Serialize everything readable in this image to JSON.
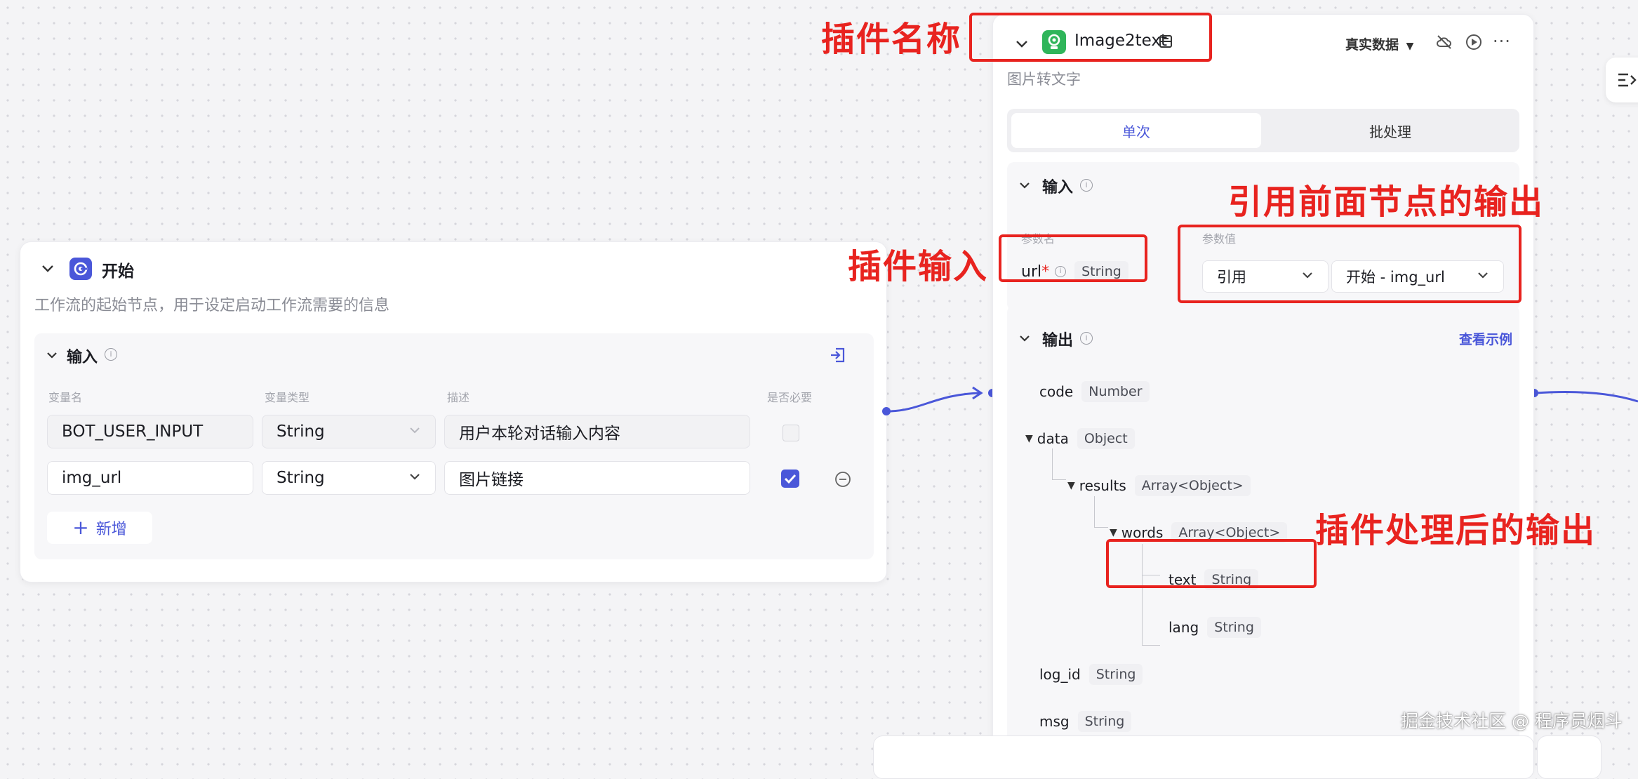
{
  "start_node": {
    "title": "开始",
    "description": "工作流的起始节点，用于设定启动工作流需要的信息",
    "input_section": {
      "title": "输入",
      "columns": [
        "变量名",
        "变量类型",
        "描述",
        "是否必要"
      ],
      "rows": [
        {
          "name": "BOT_USER_INPUT",
          "type": "String",
          "desc": "用户本轮对话输入内容",
          "required": false
        },
        {
          "name": "img_url",
          "type": "String",
          "desc": "图片链接",
          "required": true
        }
      ],
      "add_label": "新增"
    }
  },
  "plugin_node": {
    "title": "Image2text",
    "description": "图片转文字",
    "data_mode_label": "真实数据",
    "tabs": [
      "单次",
      "批处理"
    ],
    "active_tab": "单次",
    "input_section": {
      "title": "输入",
      "param_name_header": "参数名",
      "param_value_header": "参数值",
      "param": {
        "name": "url",
        "required_mark": "*",
        "type": "String"
      },
      "ref_mode": "引用",
      "ref_value": "开始 - img_url"
    },
    "output_section": {
      "title": "输出",
      "example_link": "查看示例",
      "fields": [
        {
          "name": "code",
          "type": "Number"
        },
        {
          "name": "data",
          "type": "Object"
        },
        {
          "name": "results",
          "type": "Array<Object>"
        },
        {
          "name": "words",
          "type": "Array<Object>"
        },
        {
          "name": "text",
          "type": "String"
        },
        {
          "name": "lang",
          "type": "String"
        },
        {
          "name": "log_id",
          "type": "String"
        },
        {
          "name": "msg",
          "type": "String"
        }
      ]
    }
  },
  "annotations": {
    "plugin_name": "插件名称",
    "plugin_input": "插件输入",
    "ref_output": "引用前面节点的输出",
    "processed_output": "插件处理后的输出"
  },
  "watermark": "掘金技术社区 @ 程序员烟斗",
  "colors": {
    "accent": "#4a57d9",
    "annotation": "#e8231f",
    "plugin_icon": "#2fb55a"
  }
}
